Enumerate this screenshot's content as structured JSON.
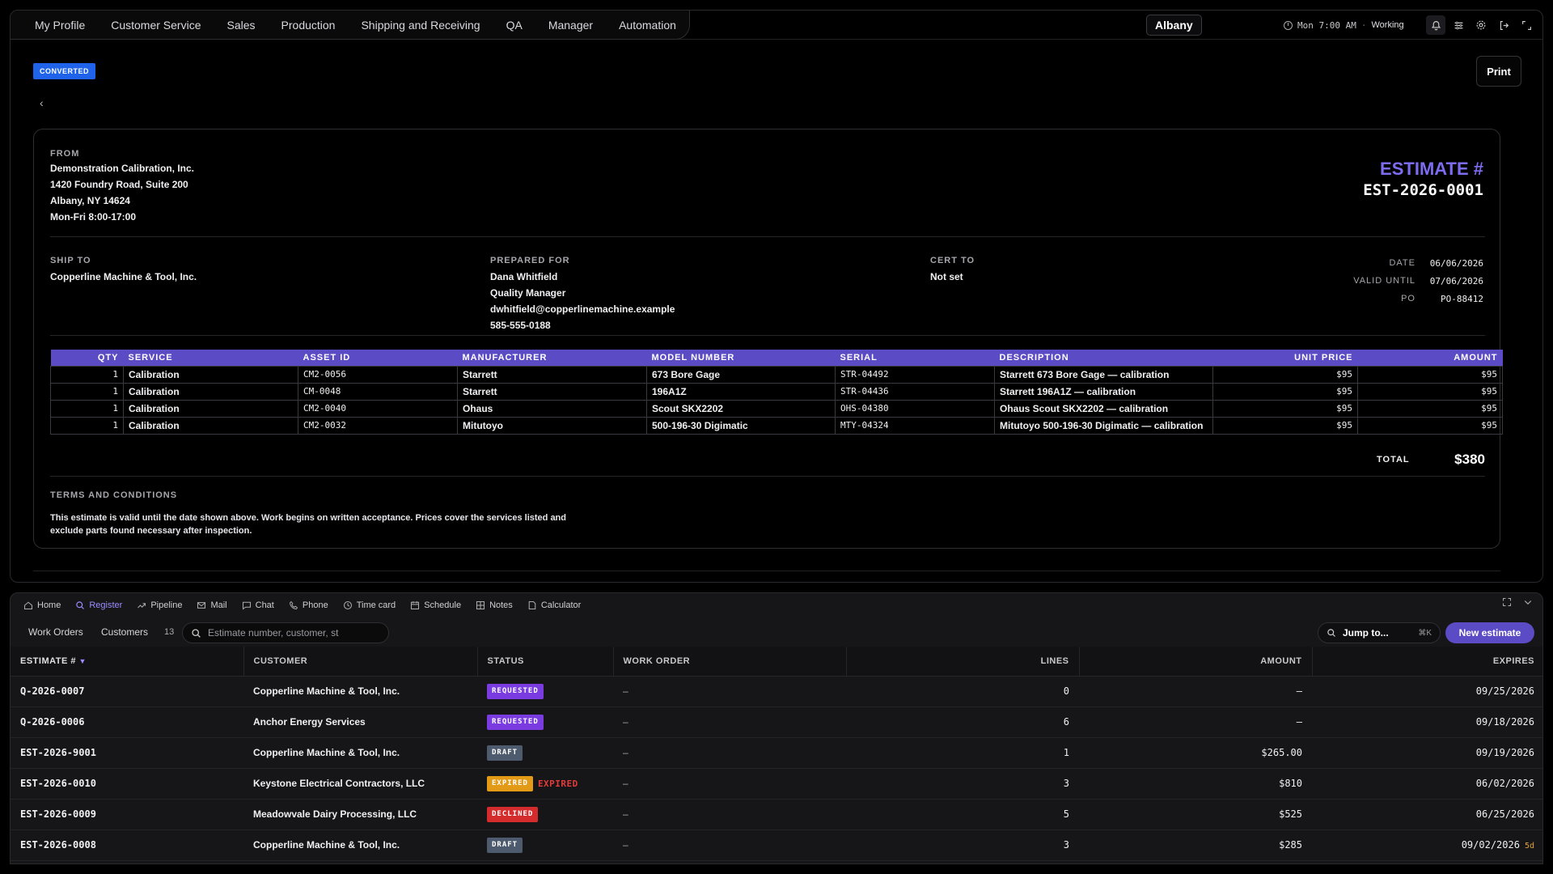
{
  "nav": {
    "items": [
      "My Profile",
      "Customer Service",
      "Sales",
      "Production",
      "Shipping and Receiving",
      "QA",
      "Manager",
      "Automation"
    ],
    "location": "Albany",
    "time": "Mon 7:00 AM",
    "separator": "·",
    "status": "Working",
    "icons": [
      "bell-icon",
      "list-settings-icon",
      "gear-icon",
      "logout-icon",
      "expand-icon"
    ]
  },
  "doc": {
    "status_badge": "CONVERTED",
    "print_label": "Print",
    "back_glyph": "‹",
    "from_label": "FROM",
    "from_lines": [
      "Demonstration Calibration, Inc.",
      "1420 Foundry Road, Suite 200",
      "Albany, NY 14624",
      "Mon-Fri 8:00-17:00"
    ],
    "title": "ESTIMATE #",
    "number": "EST-2026-0001",
    "ship_to_label": "SHIP TO",
    "ship_to": "Copperline Machine & Tool, Inc.",
    "prepared_for_label": "PREPARED FOR",
    "prepared_for": [
      "Dana Whitfield",
      "Quality Manager",
      "dwhitfield@copperlinemachine.example",
      "585-555-0188"
    ],
    "cert_to_label": "CERT TO",
    "cert_to": "Not set",
    "date_label": "DATE",
    "date": "06/06/2026",
    "valid_until_label": "VALID UNTIL",
    "valid_until": "07/06/2026",
    "po_label": "PO",
    "po": "PO-88412",
    "columns": [
      "QTY",
      "SERVICE",
      "ASSET ID",
      "MANUFACTURER",
      "MODEL NUMBER",
      "SERIAL",
      "DESCRIPTION",
      "UNIT PRICE",
      "AMOUNT"
    ],
    "lines": [
      {
        "qty": "1",
        "service": "Calibration",
        "asset": "CM2-0056",
        "mfr": "Starrett",
        "model": "673 Bore Gage",
        "serial": "STR-04492",
        "desc": "Starrett 673 Bore Gage — calibration",
        "unit": "$95",
        "amount": "$95"
      },
      {
        "qty": "1",
        "service": "Calibration",
        "asset": "CM-0048",
        "mfr": "Starrett",
        "model": "196A1Z",
        "serial": "STR-04436",
        "desc": "Starrett 196A1Z — calibration",
        "unit": "$95",
        "amount": "$95"
      },
      {
        "qty": "1",
        "service": "Calibration",
        "asset": "CM2-0040",
        "mfr": "Ohaus",
        "model": "Scout SKX2202",
        "serial": "OHS-04380",
        "desc": "Ohaus Scout SKX2202 — calibration",
        "unit": "$95",
        "amount": "$95"
      },
      {
        "qty": "1",
        "service": "Calibration",
        "asset": "CM2-0032",
        "mfr": "Mitutoyo",
        "model": "500-196-30 Digimatic",
        "serial": "MTY-04324",
        "desc": "Mitutoyo 500-196-30 Digimatic — calibration",
        "unit": "$95",
        "amount": "$95"
      }
    ],
    "total_label": "TOTAL",
    "total": "$380",
    "terms_label": "TERMS AND CONDITIONS",
    "terms_text": "This estimate is valid until the date shown above. Work begins on written acceptance. Prices cover the services listed and exclude parts found necessary after inspection."
  },
  "dock": {
    "items": [
      {
        "label": "Home",
        "icon": "home-icon"
      },
      {
        "label": "Register",
        "icon": "search-icon",
        "active": true
      },
      {
        "label": "Pipeline",
        "icon": "trend-icon"
      },
      {
        "label": "Mail",
        "icon": "mail-icon"
      },
      {
        "label": "Chat",
        "icon": "chat-icon"
      },
      {
        "label": "Phone",
        "icon": "phone-icon"
      },
      {
        "label": "Time card",
        "icon": "clock-icon"
      },
      {
        "label": "Schedule",
        "icon": "calendar-icon"
      },
      {
        "label": "Notes",
        "icon": "grid-icon"
      },
      {
        "label": "Calculator",
        "icon": "file-icon"
      }
    ]
  },
  "register": {
    "tab_work_orders": "Work Orders",
    "tab_customers": "Customers",
    "count": "13",
    "search_placeholder": "Estimate number, customer, st",
    "jump_label": "Jump to...",
    "jump_kbd": "⌘K",
    "new_label": "New estimate",
    "columns": [
      "ESTIMATE #",
      "CUSTOMER",
      "STATUS",
      "WORK ORDER",
      "LINES",
      "AMOUNT",
      "EXPIRES"
    ],
    "sort_glyph": "▼",
    "rows": [
      {
        "num": "Q-2026-0007",
        "customer": "Copperline Machine & Tool, Inc.",
        "status": "REQUESTED",
        "status_color": "#7a3ce0",
        "extra": "",
        "wo": "–",
        "lines": "0",
        "amount": "–",
        "expires": "09/25/2026",
        "suffix": ""
      },
      {
        "num": "Q-2026-0006",
        "customer": "Anchor Energy Services",
        "status": "REQUESTED",
        "status_color": "#7a3ce0",
        "extra": "",
        "wo": "–",
        "lines": "6",
        "amount": "–",
        "expires": "09/18/2026",
        "suffix": ""
      },
      {
        "num": "EST-2026-9001",
        "customer": "Copperline Machine & Tool, Inc.",
        "status": "DRAFT",
        "status_color": "#4e5a6e",
        "extra": "",
        "wo": "–",
        "lines": "1",
        "amount": "$265.00",
        "expires": "09/19/2026",
        "suffix": ""
      },
      {
        "num": "EST-2026-0010",
        "customer": "Keystone Electrical Contractors, LLC",
        "status": "EXPIRED",
        "status_color": "#e39a17",
        "extra": "EXPIRED",
        "wo": "–",
        "lines": "3",
        "amount": "$810",
        "expires": "06/02/2026",
        "suffix": ""
      },
      {
        "num": "EST-2026-0009",
        "customer": "Meadowvale Dairy Processing, LLC",
        "status": "DECLINED",
        "status_color": "#d42c2c",
        "extra": "",
        "wo": "–",
        "lines": "5",
        "amount": "$525",
        "expires": "06/25/2026",
        "suffix": ""
      },
      {
        "num": "EST-2026-0008",
        "customer": "Copperline Machine & Tool, Inc.",
        "status": "DRAFT",
        "status_color": "#4e5a6e",
        "extra": "",
        "wo": "–",
        "lines": "3",
        "amount": "$285",
        "expires": "09/02/2026",
        "suffix": "5d"
      }
    ]
  }
}
